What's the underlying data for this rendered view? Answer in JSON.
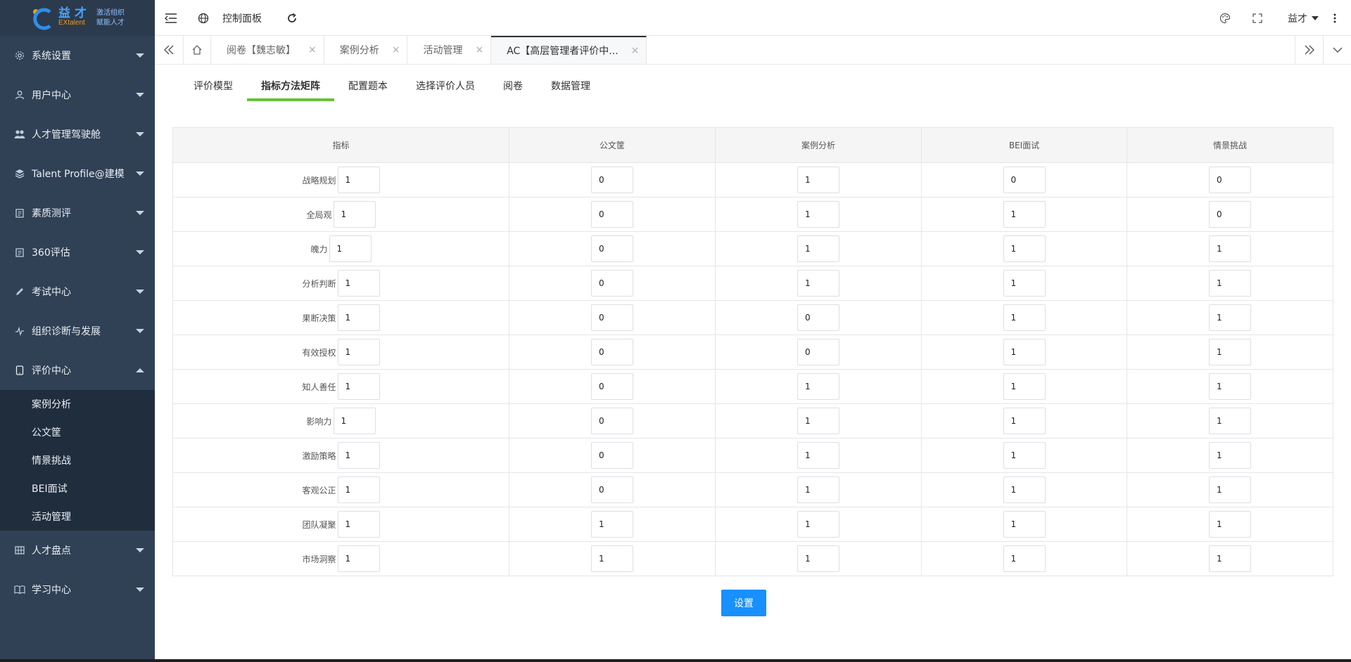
{
  "logo": {
    "cn": "益才",
    "en": "EXtalent",
    "slogan1": "激活组织",
    "slogan2": "赋能人才"
  },
  "navbar": {
    "title": "控制面板",
    "user": "益才"
  },
  "sidebar": {
    "items": [
      {
        "label": "系统设置",
        "icon": "gear-icon",
        "expanded": false
      },
      {
        "label": "用户中心",
        "icon": "user-icon",
        "expanded": false
      },
      {
        "label": "人才管理驾驶舱",
        "icon": "people-icon",
        "expanded": false
      },
      {
        "label": "Talent Profile@建模",
        "icon": "layers-icon",
        "expanded": false
      },
      {
        "label": "素质测评",
        "icon": "clipboard-icon",
        "expanded": false
      },
      {
        "label": "360评估",
        "icon": "clipboard-icon",
        "expanded": false
      },
      {
        "label": "考试中心",
        "icon": "pen-icon",
        "expanded": false
      },
      {
        "label": "组织诊断与发展",
        "icon": "pulse-icon",
        "expanded": false
      },
      {
        "label": "评价中心",
        "icon": "tablet-icon",
        "expanded": true
      },
      {
        "label": "人才盘点",
        "icon": "grid-icon",
        "expanded": false
      },
      {
        "label": "学习中心",
        "icon": "book-icon",
        "expanded": false
      }
    ],
    "submenu": [
      "案例分析",
      "公文筐",
      "情景挑战",
      "BEI面试",
      "活动管理"
    ]
  },
  "tabs": [
    {
      "label": "阅卷【魏志敏】",
      "active": false
    },
    {
      "label": "案例分析",
      "active": false
    },
    {
      "label": "活动管理",
      "active": false
    },
    {
      "label": "AC【高层管理者评价中...",
      "active": true
    }
  ],
  "subtabs": [
    {
      "label": "评价模型",
      "active": false
    },
    {
      "label": "指标方法矩阵",
      "active": true
    },
    {
      "label": "配置题本",
      "active": false
    },
    {
      "label": "选择评价人员",
      "active": false
    },
    {
      "label": "阅卷",
      "active": false
    },
    {
      "label": "数据管理",
      "active": false
    }
  ],
  "matrix": {
    "headers": [
      "指标",
      "公文筐",
      "案例分析",
      "BEI面试",
      "情景挑战"
    ],
    "rows": [
      {
        "name": "战略规划",
        "weight": "1",
        "values": [
          "0",
          "1",
          "0",
          "0"
        ]
      },
      {
        "name": "全局观",
        "weight": "1",
        "values": [
          "0",
          "1",
          "1",
          "0"
        ]
      },
      {
        "name": "魄力",
        "weight": "1",
        "values": [
          "0",
          "1",
          "1",
          "1"
        ]
      },
      {
        "name": "分析判断",
        "weight": "1",
        "values": [
          "0",
          "1",
          "1",
          "1"
        ]
      },
      {
        "name": "果断决策",
        "weight": "1",
        "values": [
          "0",
          "0",
          "1",
          "1"
        ]
      },
      {
        "name": "有效授权",
        "weight": "1",
        "values": [
          "0",
          "0",
          "1",
          "1"
        ]
      },
      {
        "name": "知人善任",
        "weight": "1",
        "values": [
          "0",
          "1",
          "1",
          "1"
        ]
      },
      {
        "name": "影响力",
        "weight": "1",
        "values": [
          "0",
          "1",
          "1",
          "1"
        ]
      },
      {
        "name": "激励策略",
        "weight": "1",
        "values": [
          "0",
          "1",
          "1",
          "1"
        ]
      },
      {
        "name": "客观公正",
        "weight": "1",
        "values": [
          "0",
          "1",
          "1",
          "1"
        ]
      },
      {
        "name": "团队凝聚",
        "weight": "1",
        "values": [
          "1",
          "1",
          "1",
          "1"
        ]
      },
      {
        "name": "市场洞察",
        "weight": "1",
        "values": [
          "1",
          "1",
          "1",
          "1"
        ]
      }
    ]
  },
  "actions": {
    "set_label": "设置"
  },
  "colors": {
    "sidebar_bg": "#304156",
    "active_tab_underline": "#67c23a",
    "primary_button": "#1890ff"
  }
}
